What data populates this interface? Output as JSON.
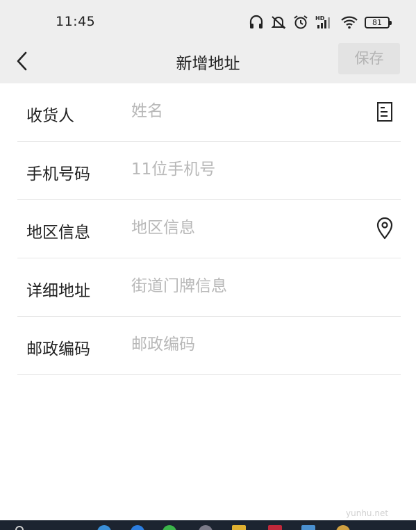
{
  "status_bar": {
    "time": "11:45",
    "battery_level": "81",
    "icons": [
      "headphones-icon",
      "silent-bell-icon",
      "alarm-icon",
      "hd-signal-icon",
      "wifi-icon",
      "battery-icon"
    ]
  },
  "nav": {
    "back_icon": "chevron-left-icon",
    "title": "新增地址",
    "save_label": "保存"
  },
  "form": {
    "rows": [
      {
        "label": "收货人",
        "placeholder": "姓名",
        "icon": "contacts-book-icon"
      },
      {
        "label": "手机号码",
        "placeholder": "11位手机号",
        "icon": ""
      },
      {
        "label": "地区信息",
        "placeholder": "地区信息",
        "icon": "location-pin-icon"
      },
      {
        "label": "详细地址",
        "placeholder": "街道门牌信息",
        "icon": ""
      },
      {
        "label": "邮政编码",
        "placeholder": "邮政编码",
        "icon": ""
      }
    ]
  },
  "watermark": "yunhu.net",
  "colors": {
    "header_bg": "#eeeeee",
    "save_button_bg": "#e3e3e3",
    "save_button_text": "#b3b3b3",
    "placeholder": "#b8b8b8",
    "divider": "#e5e5e5",
    "taskbar": "#1c2430"
  }
}
